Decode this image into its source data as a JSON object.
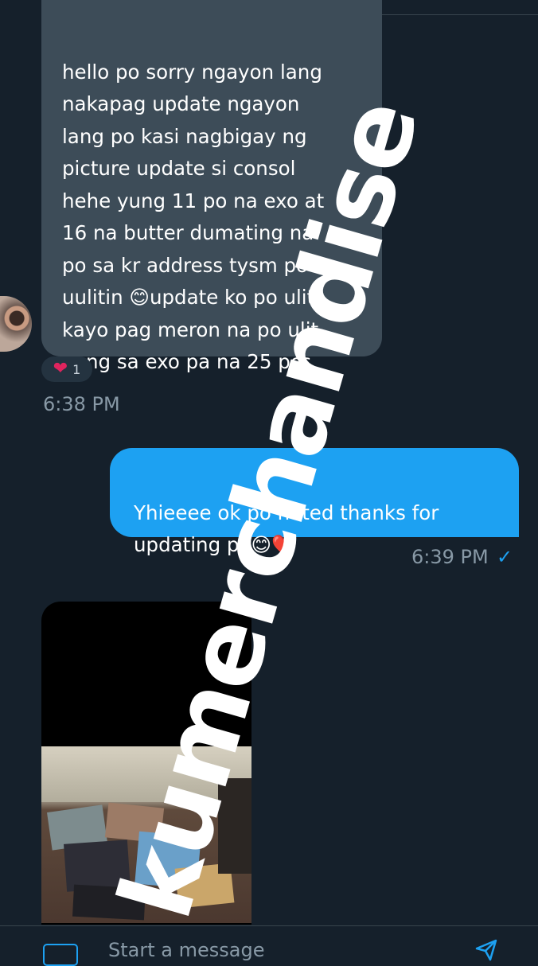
{
  "messages": {
    "incoming": {
      "text": "hello po sorry ngayon lang\nnakapag update ngayon\nlang po kasi nagbigay ng\npicture update si consol\nhehe yung 11 po na exo at\n16 na butter dumating na\npo sa kr address tysm po s\nuulitin 😊update ko po ulit\nkayo pag meron na po ulit\nyung sa exo pa na 25 pcs",
      "reaction_count": "1",
      "time": "6:38 PM"
    },
    "outgoing": {
      "text": "Yhieeee ok po noted thanks for\nupdating po😊❤️",
      "time": "6:39 PM",
      "status": "✓"
    }
  },
  "composer": {
    "placeholder": "Start a message"
  },
  "watermark": "kumerchandise",
  "colors": {
    "background": "#15202b",
    "incoming_bubble": "#3d4c58",
    "outgoing_bubble": "#1da1f2",
    "muted_text": "#8899a6"
  },
  "icons": [
    "heart-icon",
    "gif-icon",
    "send-icon"
  ]
}
